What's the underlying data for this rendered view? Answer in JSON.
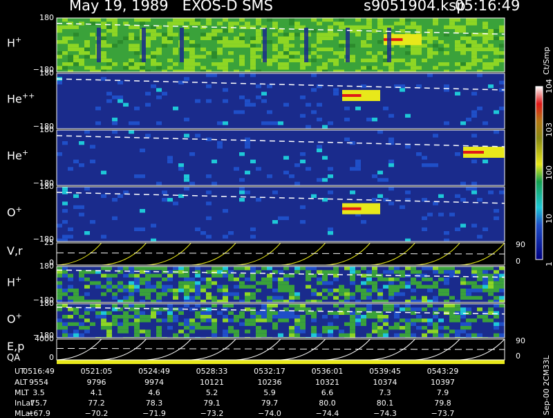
{
  "header": {
    "title": "May 19, 1989   EXOS-D SMS",
    "file": "s9051904.ksp",
    "time": "05:16:49"
  },
  "colors": {
    "low": "#1a2b8c",
    "mid_blue": "#1f4fc8",
    "cyan": "#1ec8d8",
    "green": "#3aa23a",
    "lime": "#8ed624",
    "yellow": "#e8e81a",
    "olive": "#8a8a14",
    "red": "#e01818",
    "white": "#ffffff"
  },
  "panels": [
    {
      "id": "h-plus",
      "label": "H",
      "sup": "+",
      "ymax": "180",
      "ymin": "−180"
    },
    {
      "id": "he-plusplus",
      "label": "He",
      "sup": "++",
      "ymax": "180",
      "ymin": "−180"
    },
    {
      "id": "he-plus",
      "label": "He",
      "sup": "+",
      "ymax": "180",
      "ymin": "−180"
    },
    {
      "id": "o-plus",
      "label": "O",
      "sup": "+",
      "ymax": "180",
      "ymin": "−180"
    },
    {
      "id": "vr",
      "label": "V,r",
      "sup": "",
      "ymax": "25",
      "ymin": "0",
      "rmax": "90",
      "rmin": "0"
    },
    {
      "id": "h-plus-2",
      "label": "H",
      "sup": "+",
      "ymax": "180",
      "ymin": "−180"
    },
    {
      "id": "o-plus-2",
      "label": "O",
      "sup": "+",
      "ymax": "180",
      "ymin": "−180"
    },
    {
      "id": "ep",
      "label": "E,p",
      "sup": "",
      "ymax": "4000",
      "ymin": "0",
      "rmax": "90",
      "rmin": "0"
    }
  ],
  "qa_label": "QA",
  "colorbar": {
    "unit": "Ct/Smp",
    "ticks": [
      {
        "label": "10",
        "sup": "4",
        "frac": 1.0
      },
      {
        "label": "10",
        "sup": "3",
        "frac": 0.75
      },
      {
        "label": "100",
        "sup": "",
        "frac": 0.5
      },
      {
        "label": "10",
        "sup": "",
        "frac": 0.25
      },
      {
        "label": "1",
        "sup": "",
        "frac": 0.0
      }
    ]
  },
  "table": {
    "row_labels": [
      "UT",
      "ALT",
      "MLT",
      "InLat",
      "MLat"
    ],
    "columns": [
      [
        "0516:49",
        "9554",
        "3.5",
        "75.7",
        "−67.9"
      ],
      [
        "0521:05",
        "9796",
        "4.1",
        "77.2",
        "−70.2"
      ],
      [
        "0524:49",
        "9974",
        "4.6",
        "78.3",
        "−71.9"
      ],
      [
        "0528:33",
        "10121",
        "5.2",
        "79.1",
        "−73.2"
      ],
      [
        "0532:17",
        "10236",
        "5.9",
        "79.7",
        "−74.0"
      ],
      [
        "0536:01",
        "10321",
        "6.6",
        "80.0",
        "−74.4"
      ],
      [
        "0539:45",
        "10374",
        "7.3",
        "80.1",
        "−74.3"
      ],
      [
        "0543:29",
        "10397",
        "7.9",
        "79.8",
        "−73.7"
      ]
    ]
  },
  "footer": "Sep-00 2CM33L",
  "chart_data": {
    "type": "heatmap",
    "title": "May 19, 1989   EXOS-D SMS",
    "x": [
      "0516:49",
      "0521:05",
      "0524:49",
      "0528:33",
      "0532:17",
      "0536:01",
      "0539:45",
      "0543:29"
    ],
    "colorbar_unit": "Ct/Smp",
    "colorbar_scale": "log",
    "colorbar_range": [
      1,
      10000
    ],
    "series": [
      {
        "name": "H+",
        "ylim": [
          -180,
          180
        ]
      },
      {
        "name": "He++",
        "ylim": [
          -180,
          180
        ]
      },
      {
        "name": "He+",
        "ylim": [
          -180,
          180
        ]
      },
      {
        "name": "O+",
        "ylim": [
          -180,
          180
        ]
      },
      {
        "name": "V,r",
        "ylim": [
          0,
          25
        ],
        "right_ylim": [
          0,
          90
        ]
      },
      {
        "name": "H+",
        "ylim": [
          -180,
          180
        ]
      },
      {
        "name": "O+",
        "ylim": [
          -180,
          180
        ]
      },
      {
        "name": "E,p",
        "ylim": [
          0,
          4000
        ],
        "right_ylim": [
          0,
          90
        ]
      }
    ]
  }
}
